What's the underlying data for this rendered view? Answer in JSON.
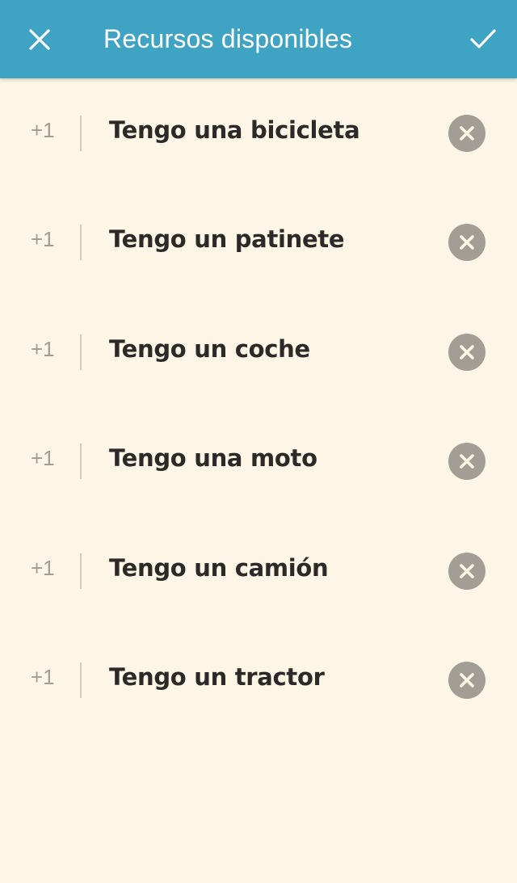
{
  "header": {
    "title": "Recursos disponibles",
    "close_icon": "close-icon",
    "confirm_icon": "check-icon",
    "background_color": "#3fa3c4"
  },
  "resources": [
    {
      "counter": "+1",
      "label": "Tengo una bicicleta"
    },
    {
      "counter": "+1",
      "label": "Tengo un patinete"
    },
    {
      "counter": "+1",
      "label": "Tengo un coche"
    },
    {
      "counter": "+1",
      "label": "Tengo una moto"
    },
    {
      "counter": "+1",
      "label": "Tengo un camión"
    },
    {
      "counter": "+1",
      "label": "Tengo un tractor"
    }
  ],
  "colors": {
    "background": "#fdf6e6",
    "remove_button": "#a39e95",
    "counter_text": "#a29d92"
  }
}
